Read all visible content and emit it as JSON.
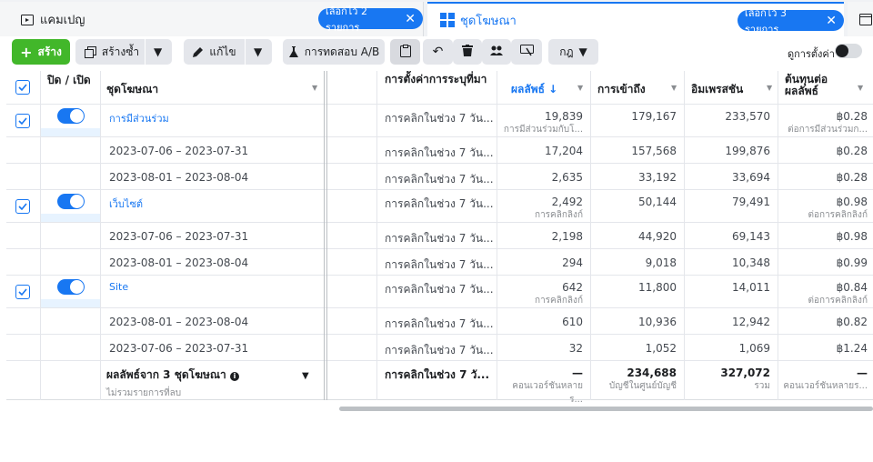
{
  "tabs": {
    "campaign": {
      "label": "แคมเปญ"
    },
    "adset": {
      "label": "ชุดโฆษณา",
      "badge": "เลือกไว้ 3 รายการ"
    },
    "campaign_badge": "เลือกไว้ 2 รายการ"
  },
  "toolbar": {
    "create": "สร้าง",
    "duplicate": "สร้างซ้ำ",
    "edit": "แก้ไข",
    "ab_test": "การทดสอบ A/B",
    "rules": "กฎ",
    "view_settings": "ดูการตั้งค่า"
  },
  "columns": {
    "onoff": "ปิด / เปิด",
    "adset": "ชุดโฆษณา",
    "attribution": "การตั้งค่าการระบุที่มา",
    "results": "ผลลัพธ์ ↓",
    "reach": "การเข้าถึง",
    "impressions": "อิมเพรสชัน",
    "cost": "ต้นทุนต่อผลลัพธ์"
  },
  "rows": [
    {
      "type": "adset",
      "name": "การมีส่วนร่วม",
      "attr": "การคลิกในช่วง 7 วัน...",
      "results": "19,839",
      "results_sub": "การมีส่วนร่วมกับโ...",
      "reach": "179,167",
      "impr": "233,570",
      "cost": "฿0.28",
      "cost_sub": "ต่อการมีส่วนร่วมก..."
    },
    {
      "type": "date",
      "name": "2023-07-06 – 2023-07-31",
      "attr": "การคลิกในช่วง 7 วัน...",
      "results": "17,204",
      "reach": "157,568",
      "impr": "199,876",
      "cost": "฿0.28"
    },
    {
      "type": "date",
      "name": "2023-08-01 – 2023-08-04",
      "attr": "การคลิกในช่วง 7 วัน...",
      "results": "2,635",
      "reach": "33,192",
      "impr": "33,694",
      "cost": "฿0.28"
    },
    {
      "type": "adset",
      "name": "เว็บไซต์",
      "attr": "การคลิกในช่วง 7 วัน...",
      "results": "2,492",
      "results_sub": "การคลิกลิงก์",
      "reach": "50,144",
      "impr": "79,491",
      "cost": "฿0.98",
      "cost_sub": "ต่อการคลิกลิงก์"
    },
    {
      "type": "date",
      "name": "2023-07-06 – 2023-07-31",
      "attr": "การคลิกในช่วง 7 วัน...",
      "results": "2,198",
      "reach": "44,920",
      "impr": "69,143",
      "cost": "฿0.98"
    },
    {
      "type": "date",
      "name": "2023-08-01 – 2023-08-04",
      "attr": "การคลิกในช่วง 7 วัน...",
      "results": "294",
      "reach": "9,018",
      "impr": "10,348",
      "cost": "฿0.99"
    },
    {
      "type": "adset",
      "name": "Site",
      "attr": "การคลิกในช่วง 7 วัน...",
      "results": "642",
      "results_sub": "การคลิกลิงก์",
      "reach": "11,800",
      "impr": "14,011",
      "cost": "฿0.84",
      "cost_sub": "ต่อการคลิกลิงก์"
    },
    {
      "type": "date",
      "name": "2023-08-01 – 2023-08-04",
      "attr": "การคลิกในช่วง 7 วัน...",
      "results": "610",
      "reach": "10,936",
      "impr": "12,942",
      "cost": "฿0.82"
    },
    {
      "type": "date",
      "name": "2023-07-06 – 2023-07-31",
      "attr": "การคลิกในช่วง 7 วัน...",
      "results": "32",
      "reach": "1,052",
      "impr": "1,069",
      "cost": "฿1.24"
    }
  ],
  "summary": {
    "title": "ผลลัพธ์จาก 3 ชุดโฆษณา",
    "subtitle": "ไม่รวมรายการที่ลบ",
    "attr": "การคลิกในช่วง 7 วั...",
    "results": "—",
    "results_sub": "คอนเวอร์ชันหลายร...",
    "reach": "234,688",
    "reach_sub": "บัญชีในศูนย์บัญชี",
    "impr": "327,072",
    "impr_sub": "รวม",
    "cost": "—",
    "cost_sub": "คอนเวอร์ชันหลายร..."
  },
  "colors": {
    "accent": "#1877f2",
    "create": "#42b72a"
  }
}
